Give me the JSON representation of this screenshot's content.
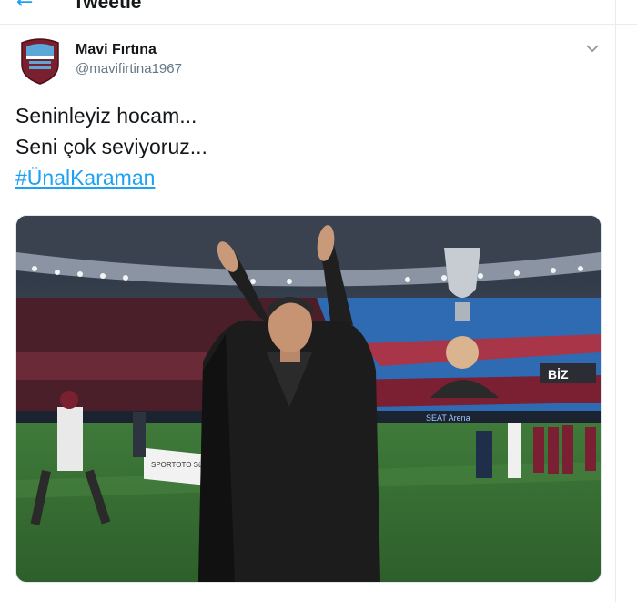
{
  "header": {
    "back_icon": "back-arrow-icon",
    "title": "Tweetle"
  },
  "tweet": {
    "author": {
      "name": "Mavi Fırtına",
      "handle": "@mavifirtina1967",
      "avatar_icon": "club-crest-icon"
    },
    "menu_icon": "chevron-down-icon",
    "text_lines": [
      "Seninleyiz hocam...",
      "Seni çok seviyoruz..."
    ],
    "hashtag": "#ÜnalKaraman",
    "media": {
      "image_icon": "stadium-photo",
      "sign_texts": [
        "SPORTOTO SüperLig",
        "BİZ",
        "SEAT Arena"
      ]
    }
  },
  "colors": {
    "link": "#1da1f2",
    "text": "#14171a",
    "muted": "#657786",
    "border": "#e6ecf0",
    "crest_maroon": "#7a1f2e",
    "crest_blue": "#5aa7d8"
  }
}
